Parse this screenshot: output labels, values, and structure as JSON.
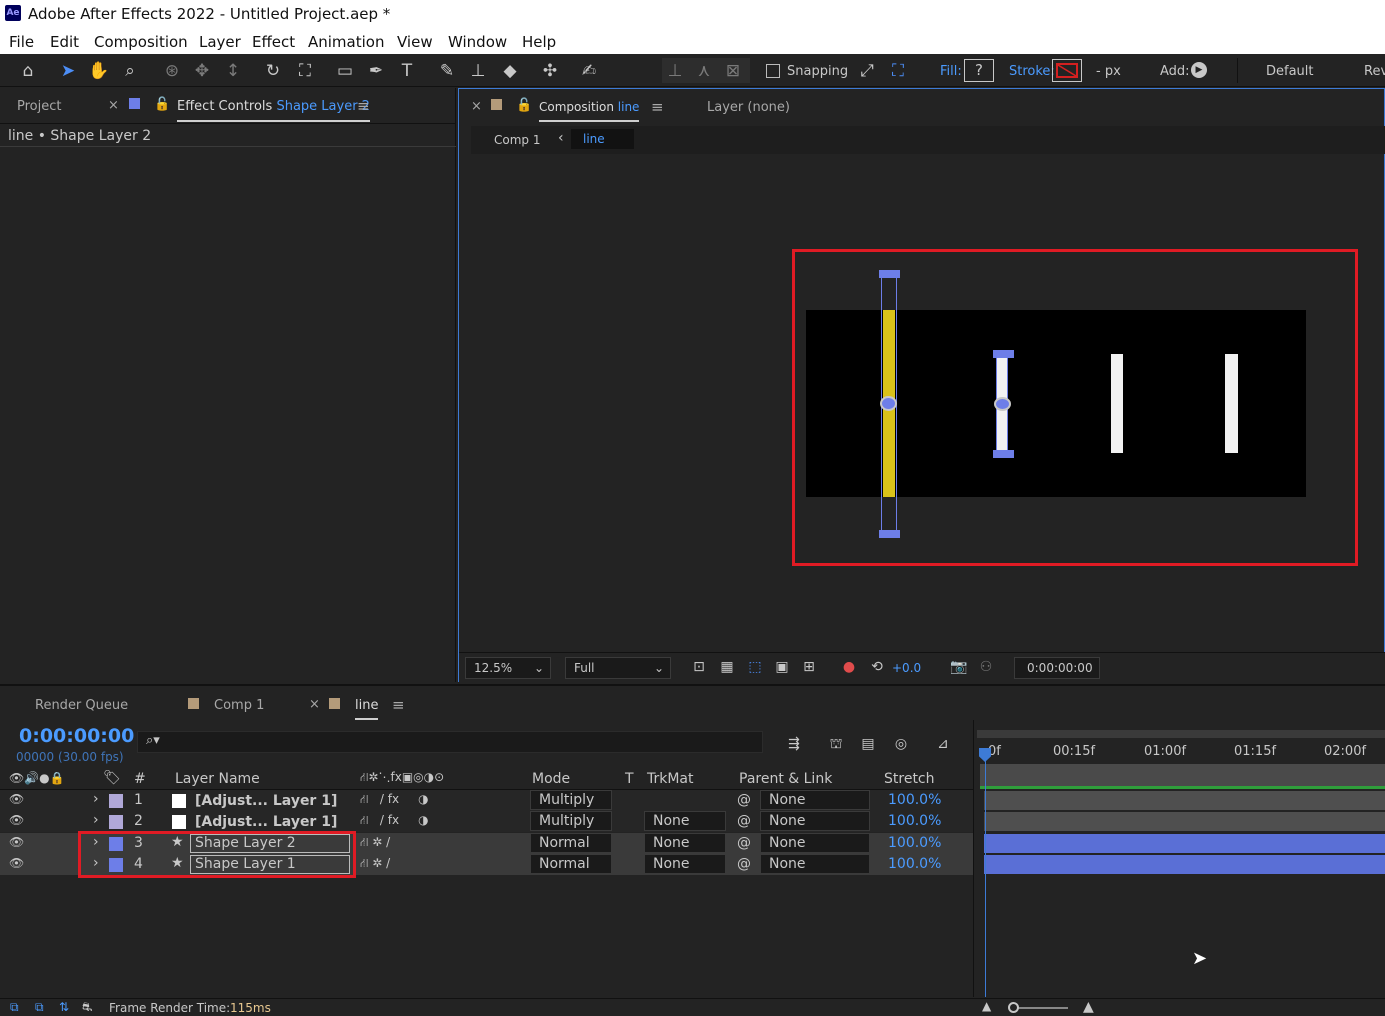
{
  "app": {
    "icon": "Ae",
    "title": "Adobe After Effects 2022 - Untitled Project.aep *"
  },
  "menu": [
    "File",
    "Edit",
    "Composition",
    "Layer",
    "Effect",
    "Animation",
    "View",
    "Window",
    "Help"
  ],
  "toolbar": {
    "snapping": "Snapping",
    "fill_label": "Fill:",
    "fill_value": "?",
    "stroke_label": "Stroke:",
    "px": "- px",
    "add_label": "Add:",
    "workspace": "Default",
    "workspace2": "Rev"
  },
  "left_panel": {
    "project_tab": "Project",
    "effect_controls_prefix": "Effect Controls",
    "effect_controls_layer": "Shape Layer 2",
    "header": "line • Shape Layer 2"
  },
  "viewer": {
    "comp_tab_prefix": "Composition",
    "comp_tab_name": "line",
    "layer_tab": "Layer (none)",
    "crumb1": "Comp 1",
    "crumb2": "line",
    "zoom": "12.5%",
    "resolution": "Full",
    "exposure": "+0.0",
    "timecode": "0:00:00:00"
  },
  "timeline_tabs": {
    "render_queue": "Render Queue",
    "comp1": "Comp 1",
    "line": "line"
  },
  "timeline": {
    "timecode": "0:00:00:00",
    "frames": "00000 (30.00 fps)",
    "search_placeholder": "",
    "columns": {
      "num": "#",
      "layer_name": "Layer Name",
      "mode": "Mode",
      "t": "T",
      "trkmat": "TrkMat",
      "parent": "Parent & Link",
      "stretch": "Stretch"
    },
    "ruler": [
      "0f",
      "00:15f",
      "01:00f",
      "01:15f",
      "02:00f"
    ],
    "layers": [
      {
        "num": "1",
        "name": "[Adjust... Layer 1]",
        "mode": "Multiply",
        "trkmat": "",
        "parent": "None",
        "stretch": "100.0%",
        "label": "#b0a8d8",
        "swatch": "#ffffff"
      },
      {
        "num": "2",
        "name": "[Adjust... Layer 1]",
        "mode": "Multiply",
        "trkmat": "None",
        "parent": "None",
        "stretch": "100.0%",
        "label": "#b0a8d8",
        "swatch": "#ffffff"
      },
      {
        "num": "3",
        "name": "Shape Layer 2",
        "mode": "Normal",
        "trkmat": "None",
        "parent": "None",
        "stretch": "100.0%",
        "label": "#6d7ee8",
        "swatch": ""
      },
      {
        "num": "4",
        "name": "Shape Layer 1",
        "mode": "Normal",
        "trkmat": "None",
        "parent": "None",
        "stretch": "100.0%",
        "label": "#6d7ee8",
        "swatch": ""
      }
    ]
  },
  "statusbar": {
    "label": "Frame Render Time:",
    "value": "115ms"
  },
  "colors": {
    "accent": "#4b9bff",
    "highlight": "#e01b24",
    "shape_bar": "#5a6fd6",
    "yellow_line": "#d9c21a"
  }
}
